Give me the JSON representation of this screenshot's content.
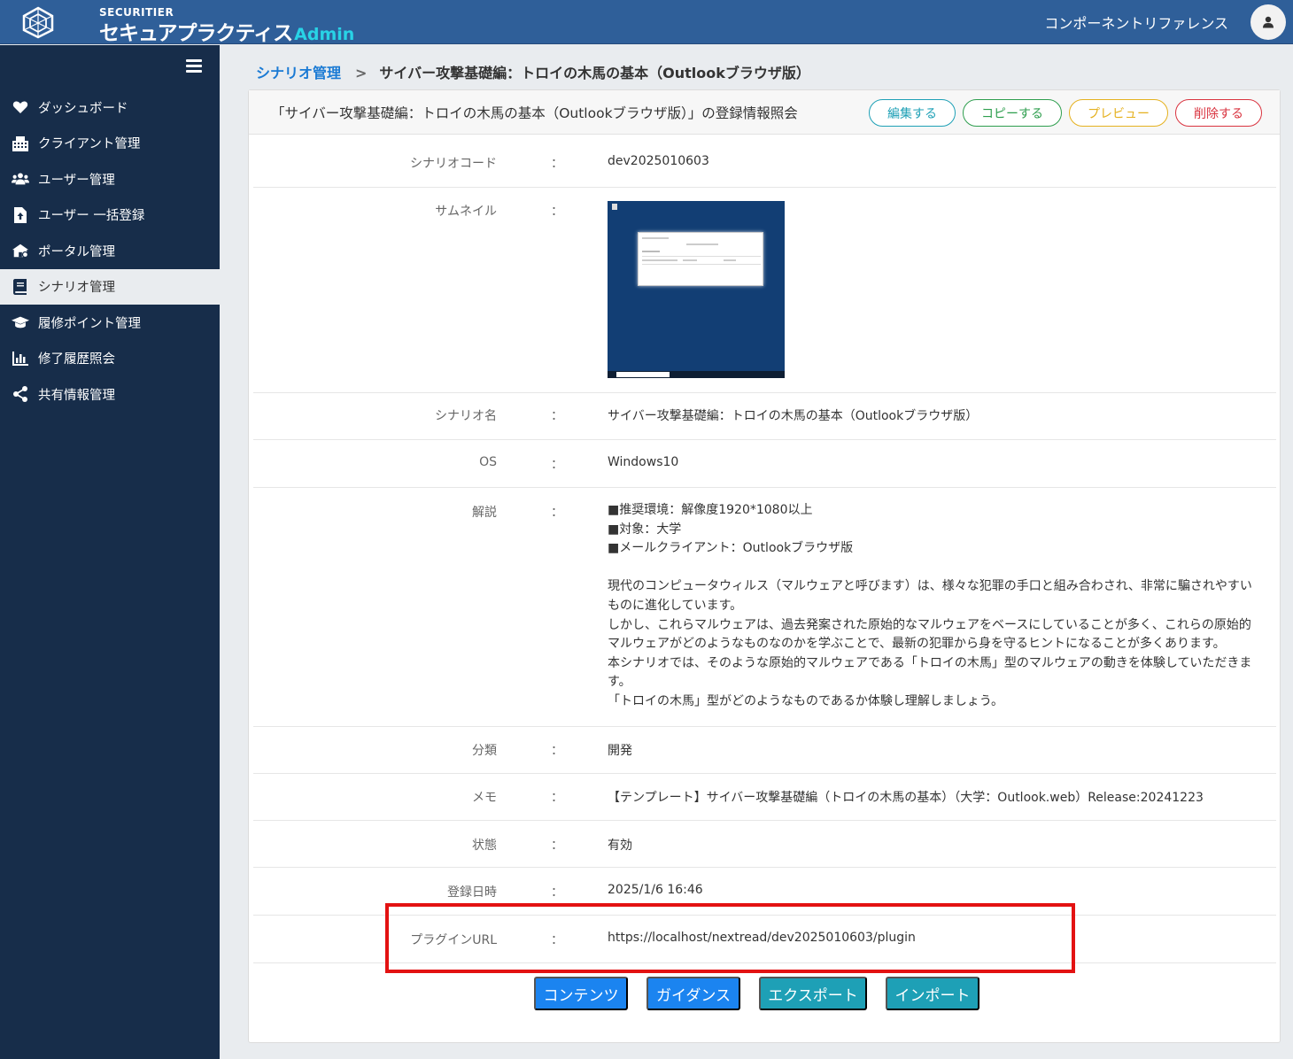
{
  "header": {
    "logo_small": "SECURITIER",
    "logo_main": "セキュアプラクティス",
    "logo_admin": "Admin",
    "component_link": "コンポーネントリファレンス"
  },
  "sidebar": {
    "items": [
      {
        "label": "ダッシュボード",
        "icon": "heart-icon"
      },
      {
        "label": "クライアント管理",
        "icon": "building-icon"
      },
      {
        "label": "ユーザー管理",
        "icon": "users-icon"
      },
      {
        "label": "ユーザー 一括登録",
        "icon": "file-upload-icon"
      },
      {
        "label": "ポータル管理",
        "icon": "home-icon"
      },
      {
        "label": "シナリオ管理",
        "icon": "book-icon",
        "active": true
      },
      {
        "label": "履修ポイント管理",
        "icon": "graduation-cap-icon"
      },
      {
        "label": "修了履歴照会",
        "icon": "bar-chart-icon"
      },
      {
        "label": "共有情報管理",
        "icon": "share-icon"
      }
    ]
  },
  "breadcrumb": {
    "parent": "シナリオ管理",
    "separator": ">",
    "current": "サイバー攻撃基礎編：トロイの木馬の基本（Outlookブラウザ版）"
  },
  "card": {
    "title": "「サイバー攻撃基礎編：トロイの木馬の基本（Outlookブラウザ版）」の登録情報照会",
    "buttons": {
      "edit": "編集する",
      "copy": "コピーする",
      "preview": "プレビュー",
      "delete": "削除する"
    }
  },
  "details": {
    "colon": "：",
    "scenario_code": {
      "label": "シナリオコード",
      "value": "dev2025010603"
    },
    "thumbnail": {
      "label": "サムネイル"
    },
    "scenario_name": {
      "label": "シナリオ名",
      "value": "サイバー攻撃基礎編：トロイの木馬の基本（Outlookブラウザ版）"
    },
    "os": {
      "label": "OS",
      "value": "Windows10"
    },
    "description": {
      "label": "解説",
      "lines": [
        "■推奨環境：解像度1920*1080以上",
        "■対象：大学",
        "■メールクライアント：Outlookブラウザ版",
        "",
        "現代のコンピュータウィルス（マルウェアと呼びます）は、様々な犯罪の手口と組み合わされ、非常に騙されやすいものに進化しています。",
        "しかし、これらマルウェアは、過去発案された原始的なマルウェアをベースにしていることが多く、これらの原始的マルウェアがどのようなものなのかを学ぶことで、最新の犯罪から身を守るヒントになることが多くあります。",
        "本シナリオでは、そのような原始的マルウェアである「トロイの木馬」型のマルウェアの動きを体験していただきます。",
        "「トロイの木馬」型がどのようなものであるか体験し理解しましょう。"
      ]
    },
    "category": {
      "label": "分類",
      "value": "開発"
    },
    "memo": {
      "label": "メモ",
      "value": "【テンプレート】サイバー攻撃基礎編（トロイの木馬の基本）（大学：Outlook.web）Release:20241223"
    },
    "status": {
      "label": "状態",
      "value": "有効"
    },
    "registered_at": {
      "label": "登録日時",
      "value": "2025/1/6 16:46"
    },
    "plugin_url": {
      "label": "プラグインURL",
      "value": "https://localhost/nextread/dev2025010603/plugin"
    }
  },
  "actions": {
    "content": "コンテンツ",
    "guidance": "ガイダンス",
    "export": "エクスポート",
    "import": "インポート"
  },
  "colors": {
    "header_bg": "#2f5f99",
    "sidebar_bg": "#172d4a",
    "highlight_box": "#e31212",
    "primary": "#1b84f0",
    "info": "#1ea0b6"
  }
}
